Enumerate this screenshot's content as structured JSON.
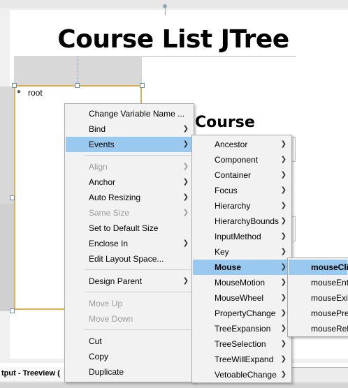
{
  "designer": {
    "title": "Course List JTree",
    "tree_root": "root",
    "course_label": "Course"
  },
  "output_tab": "tput - Treeview (",
  "context_menu": {
    "items": [
      {
        "label": "Change Variable Name ...",
        "submenu": false,
        "disabled": false
      },
      {
        "label": "Bind",
        "submenu": true,
        "disabled": false
      },
      {
        "label": "Events",
        "submenu": true,
        "disabled": false,
        "selected": true
      },
      {
        "label": "Align",
        "submenu": true,
        "disabled": true
      },
      {
        "label": "Anchor",
        "submenu": true,
        "disabled": false
      },
      {
        "label": "Auto Resizing",
        "submenu": true,
        "disabled": false
      },
      {
        "label": "Same Size",
        "submenu": true,
        "disabled": true
      },
      {
        "label": "Set to Default Size",
        "submenu": false,
        "disabled": false
      },
      {
        "label": "Enclose In",
        "submenu": true,
        "disabled": false
      },
      {
        "label": "Edit Layout Space...",
        "submenu": false,
        "disabled": false
      },
      {
        "label": "Design Parent",
        "submenu": true,
        "disabled": false
      },
      {
        "label": "Move Up",
        "submenu": false,
        "disabled": true
      },
      {
        "label": "Move Down",
        "submenu": false,
        "disabled": true
      },
      {
        "label": "Cut",
        "submenu": false,
        "disabled": false
      },
      {
        "label": "Copy",
        "submenu": false,
        "disabled": false
      },
      {
        "label": "Duplicate",
        "submenu": false,
        "disabled": false
      }
    ]
  },
  "events_menu": {
    "items": [
      {
        "label": "Ancestor"
      },
      {
        "label": "Component"
      },
      {
        "label": "Container"
      },
      {
        "label": "Focus"
      },
      {
        "label": "Hierarchy"
      },
      {
        "label": "HierarchyBounds"
      },
      {
        "label": "InputMethod"
      },
      {
        "label": "Key"
      },
      {
        "label": "Mouse",
        "selected": true
      },
      {
        "label": "MouseMotion"
      },
      {
        "label": "MouseWheel"
      },
      {
        "label": "PropertyChange"
      },
      {
        "label": "TreeExpansion"
      },
      {
        "label": "TreeSelection"
      },
      {
        "label": "TreeWillExpand"
      },
      {
        "label": "VetoableChange"
      }
    ]
  },
  "mouse_menu": {
    "items": [
      {
        "label": "mouseClic",
        "selected": true
      },
      {
        "label": "mouseEnt"
      },
      {
        "label": "mouseExit"
      },
      {
        "label": "mousePre"
      },
      {
        "label": "mouseRele"
      }
    ]
  },
  "colors": {
    "selection": "#99c9ef",
    "tree_border": "#e0b050",
    "menu_bg": "#f2f2f2"
  }
}
